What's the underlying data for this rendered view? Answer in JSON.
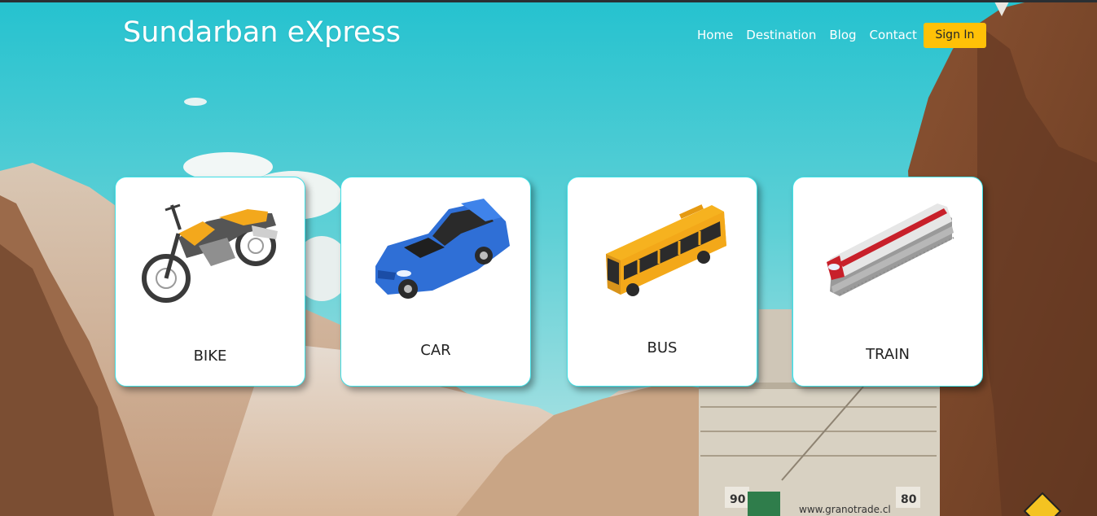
{
  "header": {
    "brand": "Sundarban eXpress",
    "nav": {
      "home": "Home",
      "destination": "Destination",
      "blog": "Blog",
      "contact": "Contact"
    },
    "signin_label": "Sign In",
    "accent_color": "#ffc107"
  },
  "cards": [
    {
      "label": "BIKE",
      "icon": "motorcycle-icon"
    },
    {
      "label": "CAR",
      "icon": "car-icon"
    },
    {
      "label": "BUS",
      "icon": "bus-icon"
    },
    {
      "label": "TRAIN",
      "icon": "train-icon"
    }
  ],
  "background": {
    "sky_color": "#3cc6d0",
    "truck_plate_left": "90",
    "truck_plate_right": "80",
    "truck_website": "www.granotrade.cl"
  }
}
